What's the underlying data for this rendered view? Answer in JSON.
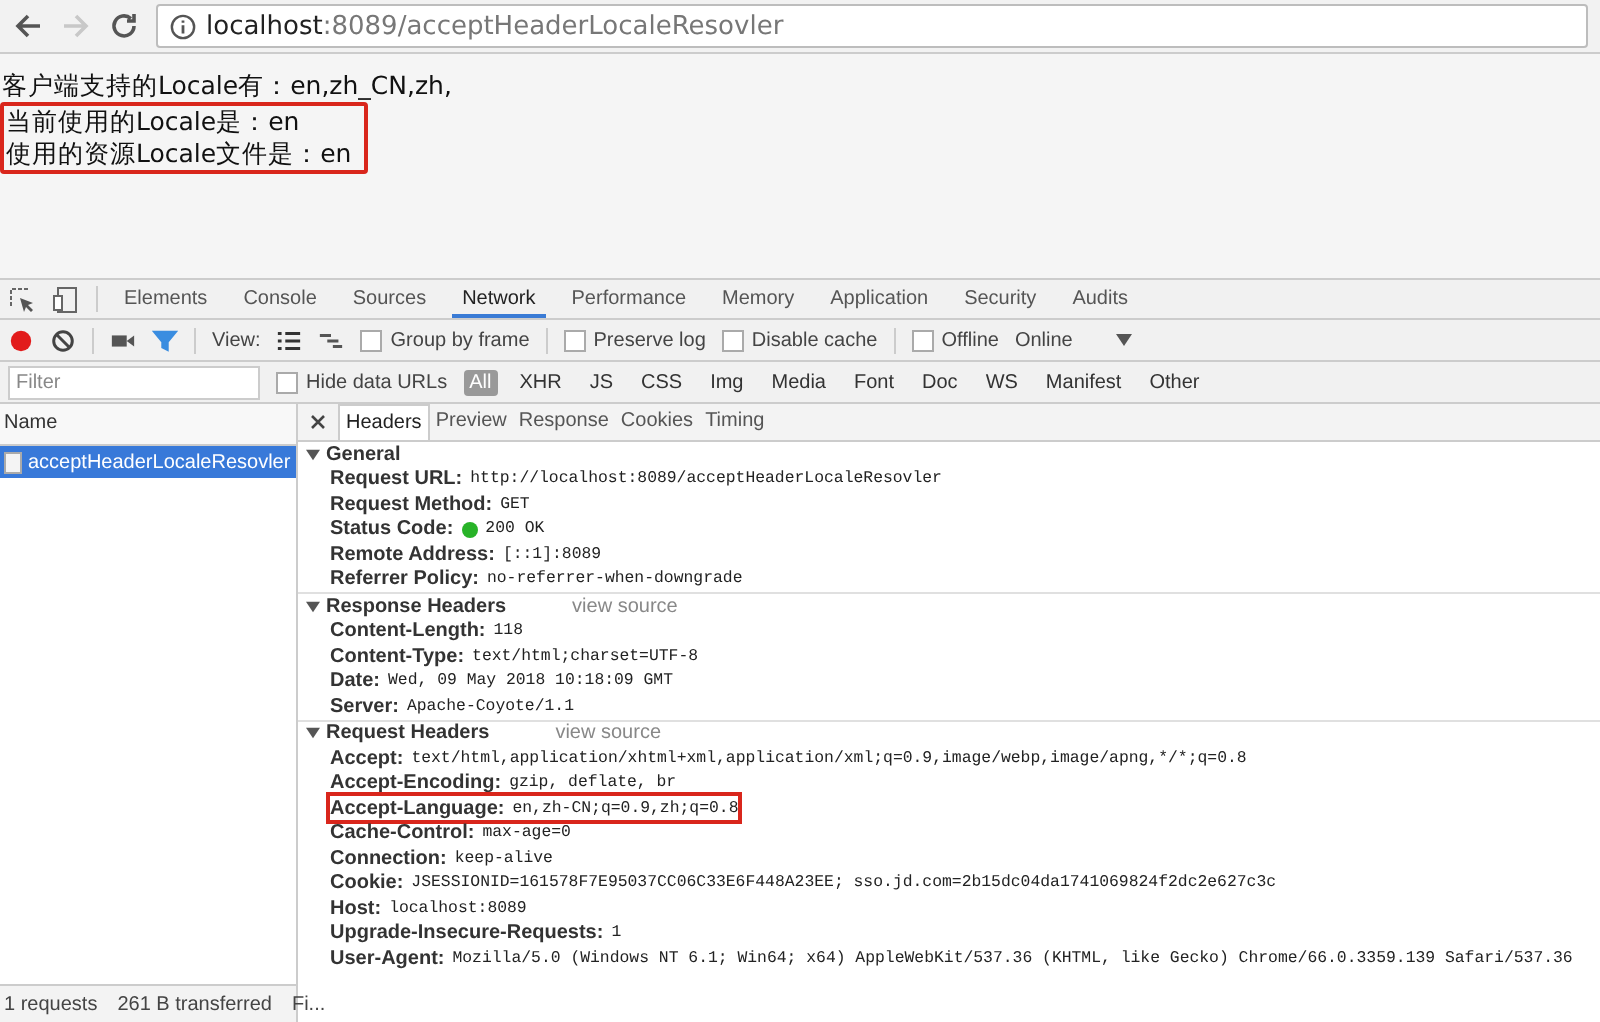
{
  "browser": {
    "back_disabled": false,
    "forward_disabled": true,
    "url_host": "localhost",
    "url_path": ":8089/acceptHeaderLocaleResovler"
  },
  "page": {
    "lines": [
      {
        "text": "客户端支持的Locale有：en,zh_CN,zh,",
        "highlighted": false
      },
      {
        "text": "当前使用的Locale是：en",
        "highlighted": true
      },
      {
        "text": "使用的资源Locale文件是：en",
        "highlighted": true
      }
    ]
  },
  "devtools": {
    "tabs": [
      {
        "label": "Elements",
        "selected": false
      },
      {
        "label": "Console",
        "selected": false
      },
      {
        "label": "Sources",
        "selected": false
      },
      {
        "label": "Network",
        "selected": true
      },
      {
        "label": "Performance",
        "selected": false
      },
      {
        "label": "Memory",
        "selected": false
      },
      {
        "label": "Application",
        "selected": false
      },
      {
        "label": "Security",
        "selected": false
      },
      {
        "label": "Audits",
        "selected": false
      }
    ],
    "toolbar": {
      "recording": true,
      "filter_active": true,
      "view_label": "View:",
      "checkboxes": [
        {
          "label": "Group by frame",
          "checked": false
        },
        {
          "label": "Preserve log",
          "checked": false
        },
        {
          "label": "Disable cache",
          "checked": false
        },
        {
          "label": "Offline",
          "checked": false
        }
      ],
      "throttling": "Online"
    },
    "filter": {
      "placeholder": "Filter",
      "hide_data_urls": {
        "label": "Hide data URLs",
        "checked": false
      },
      "types": [
        {
          "label": "All",
          "selected": true
        },
        {
          "label": "XHR",
          "selected": false
        },
        {
          "label": "JS",
          "selected": false
        },
        {
          "label": "CSS",
          "selected": false
        },
        {
          "label": "Img",
          "selected": false
        },
        {
          "label": "Media",
          "selected": false
        },
        {
          "label": "Font",
          "selected": false
        },
        {
          "label": "Doc",
          "selected": false
        },
        {
          "label": "WS",
          "selected": false
        },
        {
          "label": "Manifest",
          "selected": false
        },
        {
          "label": "Other",
          "selected": false
        }
      ]
    },
    "requests": {
      "column": "Name",
      "items": [
        {
          "name": "acceptHeaderLocaleResovler",
          "selected": true
        }
      ]
    },
    "status_bar": [
      "1 requests",
      "261 B transferred",
      "Fi..."
    ],
    "detail_tabs": [
      {
        "label": "Headers",
        "selected": true
      },
      {
        "label": "Preview",
        "selected": false
      },
      {
        "label": "Response",
        "selected": false
      },
      {
        "label": "Cookies",
        "selected": false
      },
      {
        "label": "Timing",
        "selected": false
      }
    ],
    "sections": [
      {
        "title": "General",
        "expanded": true,
        "rows": [
          {
            "name": "Request URL:",
            "value": "http://localhost:8089/acceptHeaderLocaleResovler",
            "highlighted": false
          },
          {
            "name": "Request Method:",
            "value": "GET",
            "highlighted": false
          },
          {
            "name": "Status Code:",
            "value": "200 OK",
            "highlighted": false,
            "color": "#28b328"
          },
          {
            "name": "Remote Address:",
            "value": "[::1]:8089",
            "highlighted": false
          },
          {
            "name": "Referrer Policy:",
            "value": "no-referrer-when-downgrade",
            "highlighted": false
          }
        ]
      },
      {
        "title": "Response Headers",
        "link": "view source",
        "expanded": true,
        "rows": [
          {
            "name": "Content-Length:",
            "value": "118",
            "highlighted": false
          },
          {
            "name": "Content-Type:",
            "value": "text/html;charset=UTF-8",
            "highlighted": false
          },
          {
            "name": "Date:",
            "value": "Wed, 09 May 2018 10:18:09 GMT",
            "highlighted": false
          },
          {
            "name": "Server:",
            "value": "Apache-Coyote/1.1",
            "highlighted": false
          }
        ]
      },
      {
        "title": "Request Headers",
        "link": "view source",
        "expanded": true,
        "rows": [
          {
            "name": "Accept:",
            "value": "text/html,application/xhtml+xml,application/xml;q=0.9,image/webp,image/apng,*/*;q=0.8",
            "highlighted": false
          },
          {
            "name": "Accept-Encoding:",
            "value": "gzip, deflate, br",
            "highlighted": false
          },
          {
            "name": "Accept-Language:",
            "value": "en,zh-CN;q=0.9,zh;q=0.8",
            "highlighted": true
          },
          {
            "name": "Cache-Control:",
            "value": "max-age=0",
            "highlighted": false
          },
          {
            "name": "Connection:",
            "value": "keep-alive",
            "highlighted": false
          },
          {
            "name": "Cookie:",
            "value": "JSESSIONID=161578F7E95037CC06C33E6F448A23EE; sso.jd.com=2b15dc04da1741069824f2dc2e627c3c",
            "highlighted": false
          },
          {
            "name": "Host:",
            "value": "localhost:8089",
            "highlighted": false
          },
          {
            "name": "Upgrade-Insecure-Requests:",
            "value": "1",
            "highlighted": false
          },
          {
            "name": "User-Agent:",
            "value": "Mozilla/5.0 (Windows NT 6.1; Win64; x64) AppleWebKit/537.36 (KHTML, like Gecko) Chrome/66.0.3359.139 Safari/537.36",
            "highlighted": false
          }
        ]
      }
    ]
  }
}
